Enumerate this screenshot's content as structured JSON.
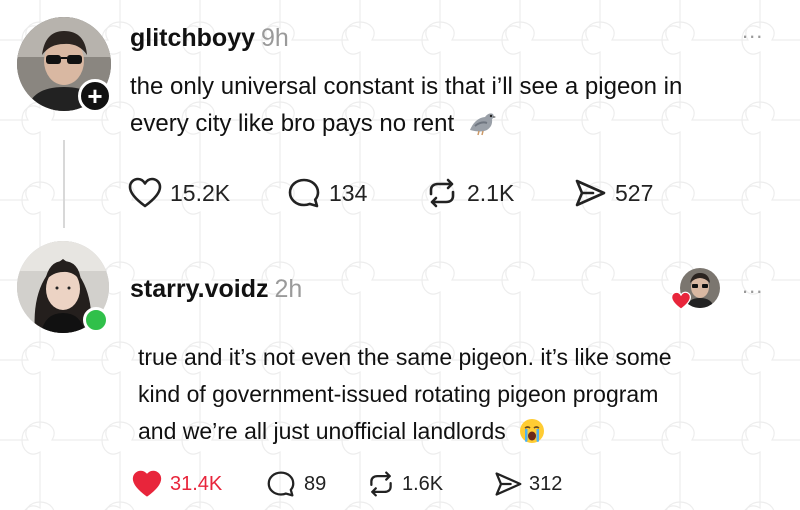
{
  "posts": [
    {
      "username": "glitchboyy",
      "time": "9h",
      "text_line1": "the only universal constant is that i’ll see a pigeon in",
      "text_line2": "every city like bro pays no rent",
      "emoji": "pigeon",
      "more": "...",
      "stats": {
        "likes": "15.2K",
        "replies": "134",
        "reposts": "2.1K",
        "shares": "527"
      },
      "liked": false
    },
    {
      "username": "starry.voidz",
      "time": "2h",
      "text_line1": "true and it’s not even the same pigeon. it’s like some",
      "text_line2": "kind of government-issued rotating pigeon program",
      "text_line3": "and we’re all just unofficial landlords",
      "emoji": "crying-face",
      "more": "...",
      "stats": {
        "likes": "31.4K",
        "replies": "89",
        "reposts": "1.6K",
        "shares": "312"
      },
      "liked": true,
      "like_color": "#e8253b"
    }
  ],
  "icons": {
    "follow": "plus-icon",
    "online": "online-dot",
    "like": "heart-icon",
    "reply": "comment-icon",
    "repost": "repost-icon",
    "share": "share-icon"
  }
}
